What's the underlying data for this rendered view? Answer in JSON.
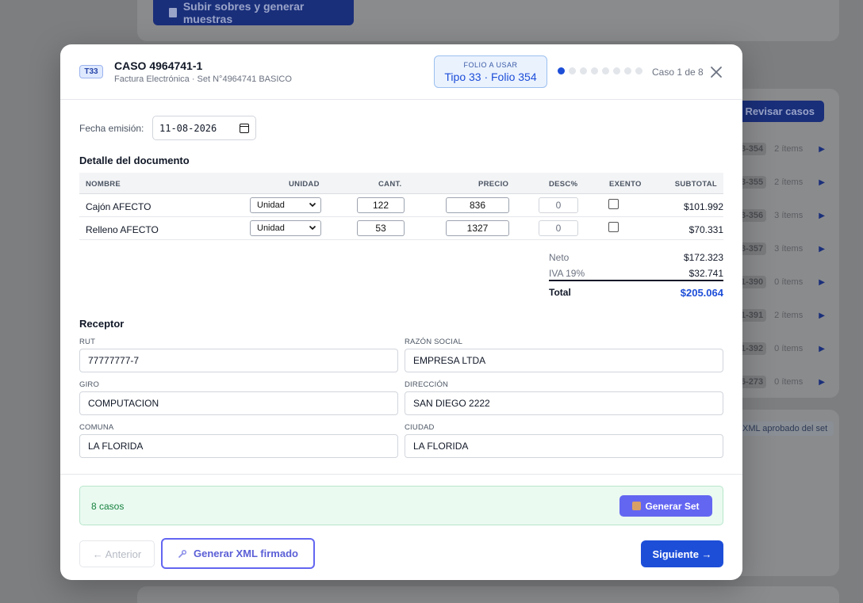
{
  "background": {
    "upload_button": "Subir sobres y generar muestras",
    "review_button": "Revisar casos",
    "rows": [
      {
        "code": "3-354",
        "items": "2 ítems"
      },
      {
        "code": "3-355",
        "items": "2 ítems"
      },
      {
        "code": "3-356",
        "items": "3 ítems"
      },
      {
        "code": "3-357",
        "items": "3 ítems"
      },
      {
        "code": "1-390",
        "items": "0 ítems"
      },
      {
        "code": "1-391",
        "items": "2 ítems"
      },
      {
        "code": "1-392",
        "items": "0 ítems"
      },
      {
        "code": "6-273",
        "items": "0 ítems"
      }
    ],
    "xml_pill": "XML aprobado del set"
  },
  "modal": {
    "type_badge": "T33",
    "title": "CASO 4964741-1",
    "subtitle": "Factura Electrónica · Set N°4964741 BASICO",
    "folio_label": "FOLIO A USAR",
    "folio_value": "Tipo 33 · Folio 354",
    "case_count": "Caso 1 de 8",
    "progress": {
      "current": 1,
      "total": 8
    }
  },
  "emission": {
    "label": "Fecha emisión:",
    "date": "11-08-2026"
  },
  "detail": {
    "title": "Detalle del documento",
    "columns": [
      "NOMBRE",
      "UNIDAD",
      "CANT.",
      "PRECIO",
      "DESC%",
      "EXENTO",
      "SUBTOTAL"
    ],
    "rows": [
      {
        "name": "Cajón AFECTO",
        "unit": "Unidad",
        "qty": "122",
        "price": "836",
        "disc": "0",
        "subtotal": "$101.992"
      },
      {
        "name": "Relleno AFECTO",
        "unit": "Unidad",
        "qty": "53",
        "price": "1327",
        "disc": "0",
        "subtotal": "$70.331"
      }
    ]
  },
  "totals": {
    "neto_label": "Neto",
    "neto": "$172.323",
    "iva_label": "IVA 19%",
    "iva": "$32.741",
    "total_label": "Total",
    "total": "$205.064"
  },
  "receptor": {
    "title": "Receptor",
    "rut_label": "RUT",
    "rut": "77777777-7",
    "razon_label": "RAZÓN SOCIAL",
    "razon": "EMPRESA LTDA",
    "giro_label": "GIRO",
    "giro": "COMPUTACION",
    "direccion_label": "DIRECCIÓN",
    "direccion": "SAN DIEGO 2222",
    "comuna_label": "COMUNA",
    "comuna": "LA FLORIDA",
    "ciudad_label": "CIUDAD",
    "ciudad": "LA FLORIDA"
  },
  "footer": {
    "cases_text": "8 casos",
    "generate_set": "Generar Set",
    "prev": "← Anterior",
    "xml": "Generar XML firmado",
    "next": "Siguiente →"
  },
  "colors": {
    "primary": "#1d4ed8",
    "accent": "#6366f1",
    "success_bg": "#eafaf1"
  }
}
